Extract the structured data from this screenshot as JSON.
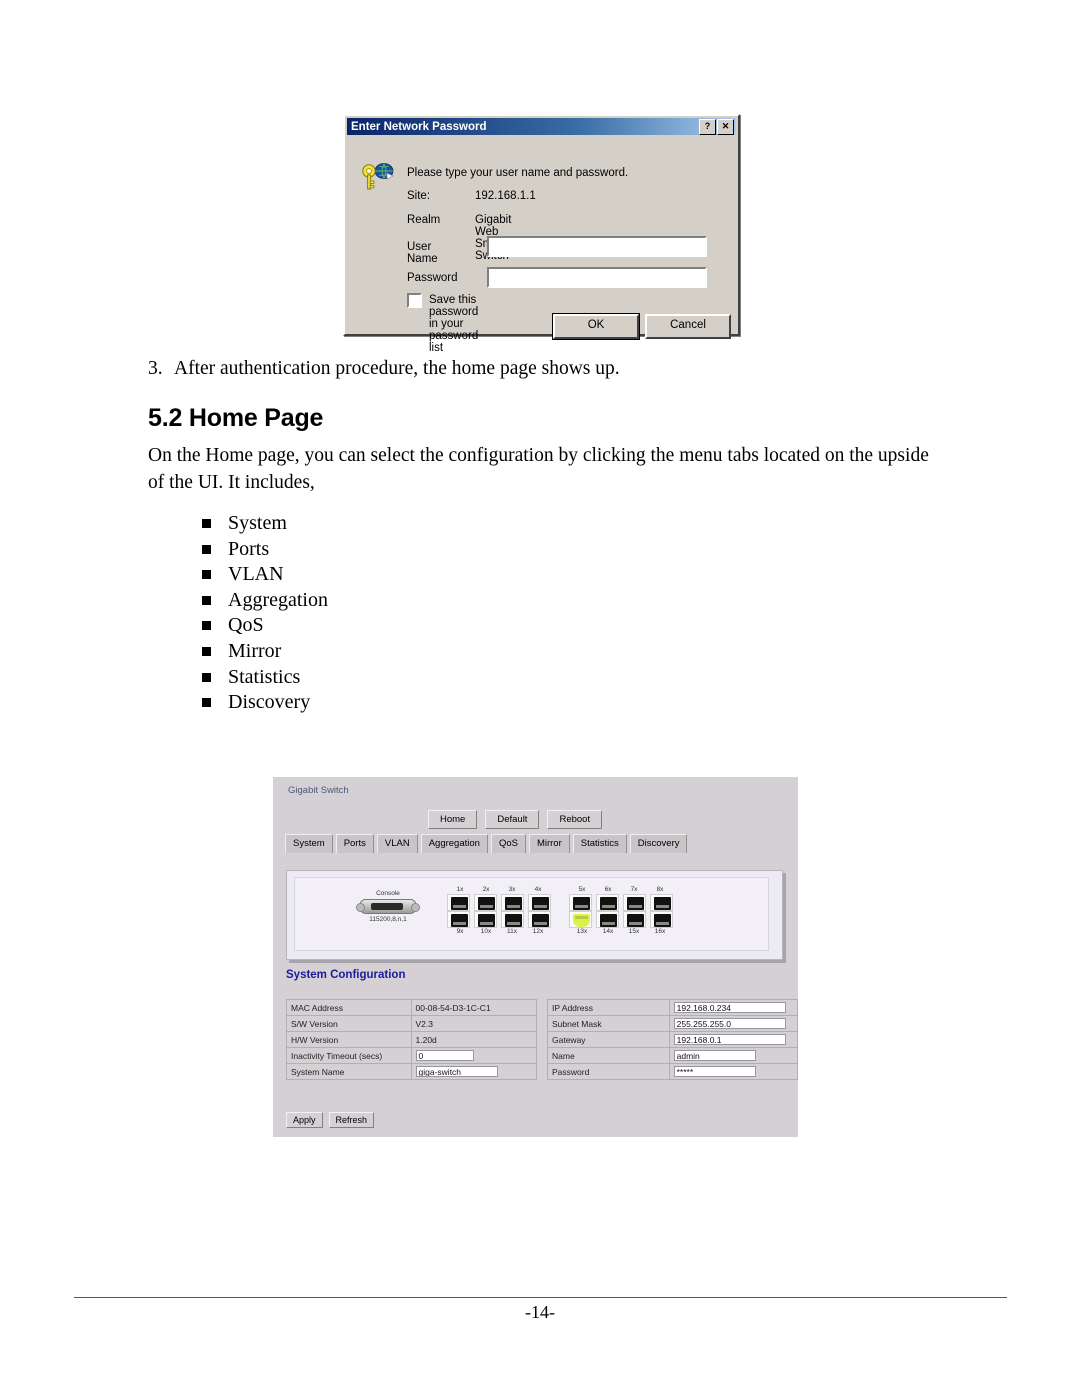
{
  "document": {
    "step": {
      "number": "3.",
      "text": "After authentication procedure, the home page shows up."
    },
    "heading": "5.2 Home Page",
    "paragraph": "On the Home page, you can select the configuration by clicking the menu tabs located on the upside of the UI. It includes,",
    "bullets": [
      "System",
      "Ports",
      "VLAN",
      "Aggregation",
      "QoS",
      "Mirror",
      "Statistics",
      "Discovery"
    ],
    "page_number": "-14-"
  },
  "password_dialog": {
    "title": "Enter Network Password",
    "help_button": "?",
    "close_button": "✕",
    "prompt": "Please type your user name and password.",
    "site_label": "Site:",
    "site_value": "192.168.1.1",
    "realm_label": "Realm",
    "realm_value": "Gigabit Web Smart Switch",
    "user_name_label": "User Name",
    "user_name_value": "",
    "password_label": "Password",
    "password_value": "",
    "save_checkbox_label": "Save this password in your password list",
    "save_checkbox_checked": false,
    "ok_button": "OK",
    "cancel_button": "Cancel"
  },
  "switch_ui": {
    "brand": "Gigabit Switch",
    "top_buttons": [
      "Home",
      "Default",
      "Reboot"
    ],
    "tabs": [
      "System",
      "Ports",
      "VLAN",
      "Aggregation",
      "QoS",
      "Mirror",
      "Statistics",
      "Discovery"
    ],
    "front_panel": {
      "console_label": "Console",
      "console_settings": "115200,8,n,1",
      "group1_top_labels": [
        "1x",
        "2x",
        "3x",
        "4x"
      ],
      "group1_bottom_labels": [
        "9x",
        "10x",
        "11x",
        "12x"
      ],
      "group2_top_labels": [
        "5x",
        "6x",
        "7x",
        "8x"
      ],
      "group2_bottom_labels": [
        "13x",
        "14x",
        "15x",
        "16x"
      ],
      "active_port": "13x",
      "active_port_color": "#d9f24a"
    },
    "section_title": "System Configuration",
    "left_table": [
      {
        "label": "MAC Address",
        "value": "00-08-54-D3-1C-C1",
        "input": false
      },
      {
        "label": "S/W Version",
        "value": "V2.3",
        "input": false
      },
      {
        "label": "H/W Version",
        "value": "1.20d",
        "input": false
      },
      {
        "label": "Inactivity Timeout (secs)",
        "value": "0",
        "input": true
      },
      {
        "label": "System Name",
        "value": "giga-switch",
        "input": true
      }
    ],
    "right_table": [
      {
        "label": "IP Address",
        "value": "192.168.0.234",
        "input": true
      },
      {
        "label": "Subnet Mask",
        "value": "255.255.255.0",
        "input": true
      },
      {
        "label": "Gateway",
        "value": "192.168.0.1",
        "input": true
      },
      {
        "label": "Name",
        "value": "admin",
        "input": true
      },
      {
        "label": "Password",
        "value": "*****",
        "input": true
      }
    ],
    "bottom_buttons": [
      "Apply",
      "Refresh"
    ],
    "section_title_color": "#1a1aa0"
  }
}
